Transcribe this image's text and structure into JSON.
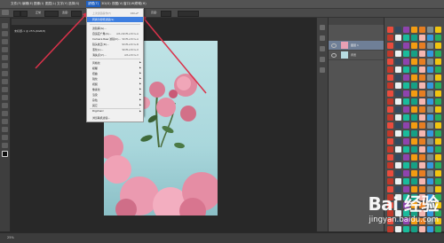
{
  "menubar": {
    "items": [
      {
        "label": "文件(F)"
      },
      {
        "label": "编辑(E)"
      },
      {
        "label": "图像(I)"
      },
      {
        "label": "图层(L)"
      },
      {
        "label": "文字(Y)"
      },
      {
        "label": "选择(S)"
      },
      {
        "label": "滤镜(T)"
      },
      {
        "label": "3D(D)"
      },
      {
        "label": "视图(V)"
      },
      {
        "label": "窗口(W)"
      },
      {
        "label": "帮助(H)"
      }
    ]
  },
  "optionsbar": {
    "mode_label": "正常",
    "width_label": "宽度:",
    "height_label": "高度:",
    "refine_button": "调整边缘..."
  },
  "document": {
    "tab_label": "未标题-1 @ 25%(RGB/8)"
  },
  "dropdown": {
    "items": [
      {
        "label": "上次滤镜操作(F)",
        "shortcut": "Ctrl+F",
        "disabled": true
      },
      {
        "label": "转换为智能滤镜(S)",
        "shortcut": "",
        "highlighted": true
      },
      {
        "sep": true
      },
      {
        "label": "滤镜库(G)...",
        "shortcut": ""
      },
      {
        "label": "自适应广角(A)...",
        "shortcut": "Alt+Shift+Ctrl+A"
      },
      {
        "label": "Camera Raw 滤镜(C)...",
        "shortcut": "Shift+Ctrl+A"
      },
      {
        "label": "镜头校正(R)...",
        "shortcut": "Shift+Ctrl+R"
      },
      {
        "label": "液化(L)...",
        "shortcut": "Shift+Ctrl+X"
      },
      {
        "label": "消失点(V)...",
        "shortcut": "Alt+Ctrl+V"
      },
      {
        "sep": true
      },
      {
        "label": "风格化",
        "submenu": true
      },
      {
        "label": "模糊",
        "submenu": true
      },
      {
        "label": "扭曲",
        "submenu": true
      },
      {
        "label": "锐化",
        "submenu": true
      },
      {
        "label": "视频",
        "submenu": true
      },
      {
        "label": "像素化",
        "submenu": true
      },
      {
        "label": "渲染",
        "submenu": true
      },
      {
        "label": "杂色",
        "submenu": true
      },
      {
        "label": "其它",
        "submenu": true
      },
      {
        "sep": true
      },
      {
        "label": "Digimarc",
        "submenu": true
      },
      {
        "sep": true
      },
      {
        "label": "浏览联机滤镜...",
        "shortcut": ""
      }
    ]
  },
  "layers": {
    "rows": [
      {
        "name": "图层 1",
        "selected": true
      },
      {
        "name": "背景",
        "selected": false
      }
    ]
  },
  "status": {
    "zoom": "25%"
  },
  "watermark": {
    "logo": "Bai 经验",
    "url": "jingyan.baidu.com"
  },
  "colors": {
    "accent": "#3d7ee0",
    "annotation_arrow": "#d9324a"
  }
}
